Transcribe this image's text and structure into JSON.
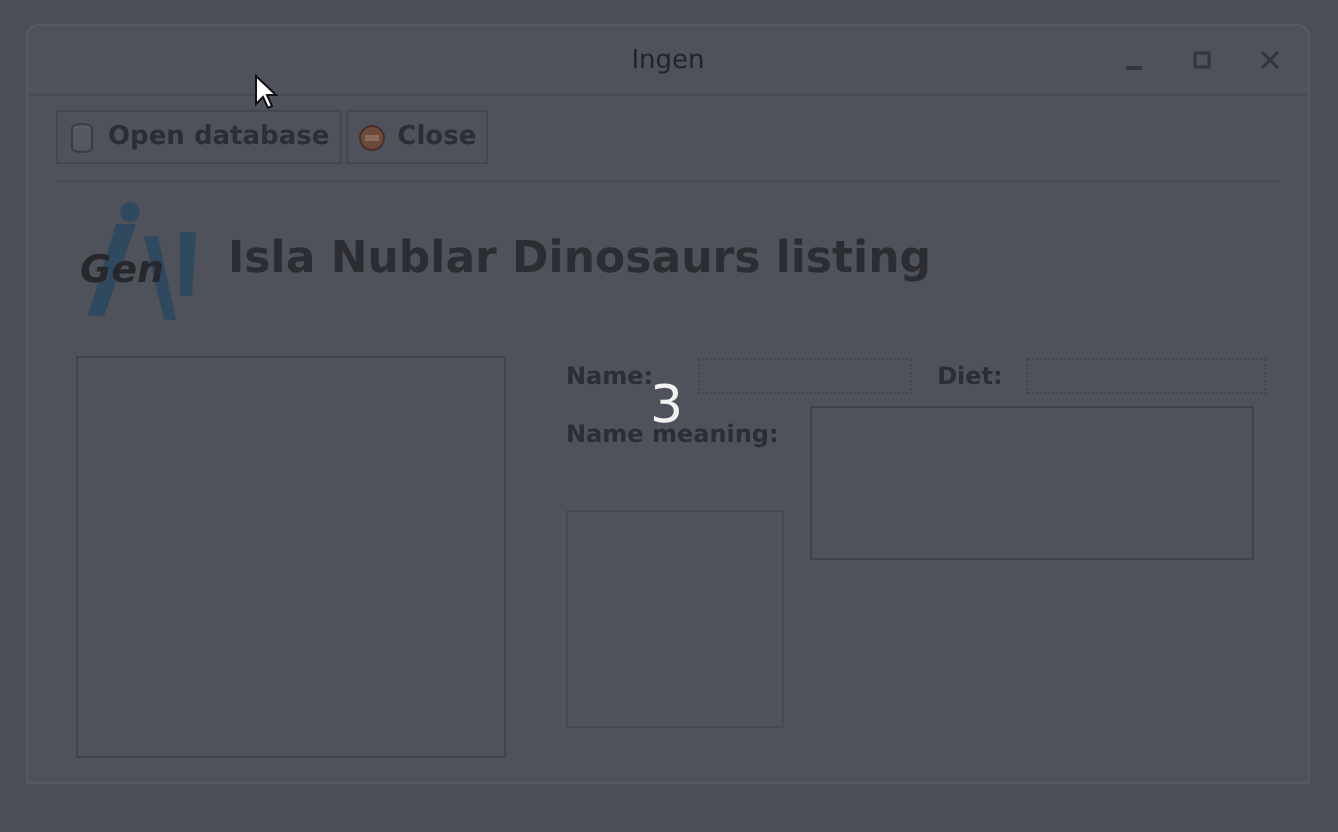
{
  "window": {
    "title": "Ingen",
    "controls": [
      {
        "kind": "minimize"
      },
      {
        "kind": "maximize"
      },
      {
        "kind": "close"
      }
    ]
  },
  "toolbar": [
    {
      "kind": "database",
      "label": "Open database"
    },
    {
      "kind": "close",
      "label": "Close"
    }
  ],
  "header": {
    "logo_text": "Gen",
    "title": "Isla Nublar Dinosaurs listing"
  },
  "form": {
    "name_label": "Name:",
    "diet_label": "Diet:",
    "meaning_label": "Name meaning:"
  },
  "overlay": {
    "countdown": "3"
  }
}
